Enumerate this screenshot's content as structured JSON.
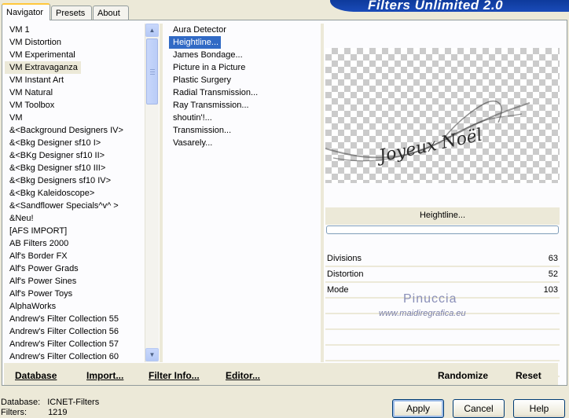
{
  "app": {
    "title": "Filters Unlimited 2.0"
  },
  "tabs": [
    {
      "label": "Navigator",
      "active": true
    },
    {
      "label": "Presets",
      "active": false
    },
    {
      "label": "About",
      "active": false
    }
  ],
  "categories": {
    "selected_index": 3,
    "items": [
      "VM 1",
      "VM Distortion",
      "VM Experimental",
      "VM Extravaganza",
      "VM Instant Art",
      "VM Natural",
      "VM Toolbox",
      "VM",
      "&<Background Designers IV>",
      "&<Bkg Designer sf10 I>",
      "&<BKg Designer sf10 II>",
      "&<Bkg Designer sf10 III>",
      "&<Bkg Designers sf10 IV>",
      "&<Bkg Kaleidoscope>",
      "&<Sandflower Specials^v^ >",
      "&Neu!",
      "[AFS IMPORT]",
      "AB Filters 2000",
      "Alf's Border FX",
      "Alf's Power Grads",
      "Alf's Power Sines",
      "Alf's Power Toys",
      "AlphaWorks",
      "Andrew's Filter Collection 55",
      "Andrew's Filter Collection 56",
      "Andrew's Filter Collection 57",
      "Andrew's Filter Collection 60"
    ]
  },
  "filters": {
    "selected_index": 1,
    "items": [
      "Aura Detector",
      "Heightline...",
      "James Bondage...",
      "Picture in a Picture",
      "Plastic Surgery",
      "Radial Transmission...",
      "Ray Transmission...",
      "shoutin'!...",
      "Transmission...",
      "Vasarely..."
    ]
  },
  "preview": {
    "filter_name": "Heightline...",
    "artwork_text": "Joyeux Noël"
  },
  "parameters": [
    {
      "label": "Divisions",
      "value": "63"
    },
    {
      "label": "Distortion",
      "value": "52"
    },
    {
      "label": "Mode",
      "value": "103"
    }
  ],
  "watermark": {
    "name": "Pinuccia",
    "url": "www.maidiregrafica.eu"
  },
  "bottom_actions": {
    "database": "Database",
    "import": "Import...",
    "filter_info": "Filter Info...",
    "editor": "Editor...",
    "randomize": "Randomize",
    "reset": "Reset"
  },
  "status": {
    "database_label": "Database:",
    "database_value": "ICNET-Filters",
    "filters_label": "Filters:",
    "filters_value": "1219"
  },
  "dialog_buttons": {
    "apply": "Apply",
    "cancel": "Cancel",
    "help": "Help"
  }
}
